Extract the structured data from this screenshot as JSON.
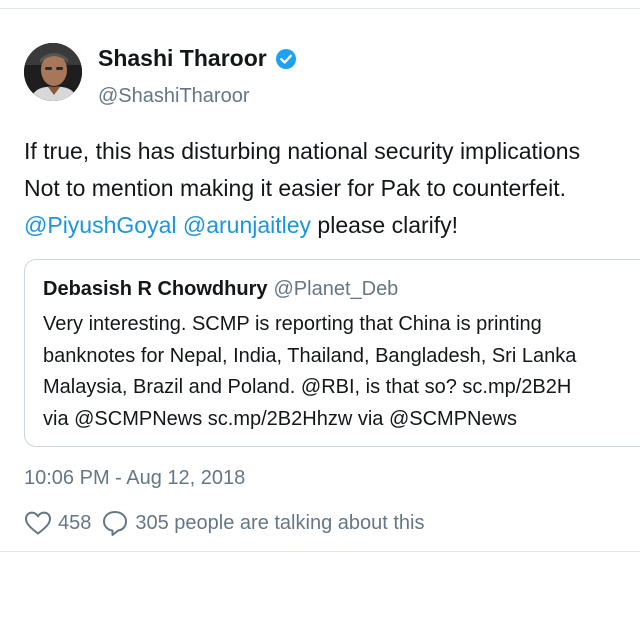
{
  "author": {
    "display_name": "Shashi Tharoor",
    "handle": "@ShashiTharoor",
    "verified_icon": "verified-badge-icon",
    "avatar": "avatar-photo"
  },
  "tweet": {
    "lines": [
      {
        "text": "If true, this has disturbing national security implications"
      },
      {
        "text": "Not to mention making it easier for Pak to counterfeit."
      },
      {
        "mention_1": "@PiyushGoyal",
        "mention_2": "@arunjaitley",
        "rest": " please clarify!"
      }
    ]
  },
  "quoted_tweet": {
    "display_name": "Debasish R Chowdhury",
    "handle": "@Planet_Deb",
    "lines": [
      "Very interesting. SCMP is reporting that China is printing",
      "banknotes for Nepal, India, Thailand, Bangladesh, Sri Lanka",
      "Malaysia, Brazil and Poland. @RBI, is that so? sc.mp/2B2H",
      "via @SCMPNews sc.mp/2B2Hhzw via @SCMPNews"
    ]
  },
  "timestamp": "10:06 PM - Aug 12, 2018",
  "actions": {
    "like_icon": "heart-icon",
    "like_count": "458",
    "reply_icon": "speech-bubble-icon",
    "reply_text": "305 people are talking about this"
  },
  "colors": {
    "text": "#14171a",
    "secondary": "#657786",
    "link": "#1b95e0",
    "verified": "#1da1f2",
    "border": "#ccd6dd"
  }
}
